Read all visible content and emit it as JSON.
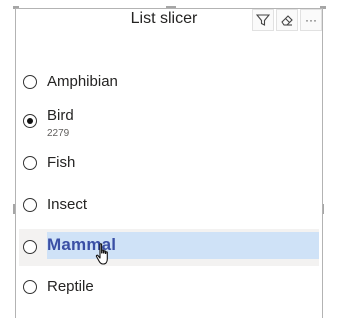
{
  "slicer": {
    "title": "List slicer",
    "header_icons": [
      "filter-icon",
      "eraser-icon",
      "more-options-icon"
    ],
    "more_label": "···",
    "items": [
      {
        "label": "Amphibian",
        "selected": false,
        "count": ""
      },
      {
        "label": "Bird",
        "selected": true,
        "count": "2279"
      },
      {
        "label": "Fish",
        "selected": false,
        "count": ""
      },
      {
        "label": "Insect",
        "selected": false,
        "count": ""
      },
      {
        "label": "Mammal",
        "selected": false,
        "count": "",
        "hovered": true
      },
      {
        "label": "Reptile",
        "selected": false,
        "count": ""
      }
    ]
  },
  "colors": {
    "highlight_bg": "#cfe2f7",
    "highlight_text": "#3a4fa5",
    "border": "#b3b3b3"
  }
}
